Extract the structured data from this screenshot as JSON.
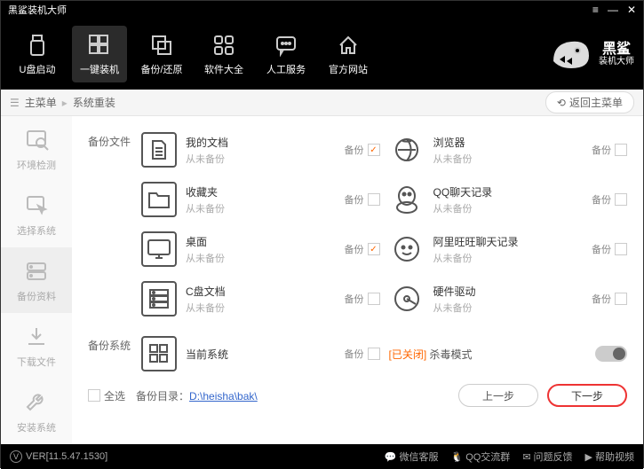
{
  "window": {
    "title": "黑鲨装机大师"
  },
  "nav": {
    "items": [
      {
        "label": "U盘启动"
      },
      {
        "label": "一键装机"
      },
      {
        "label": "备份/还原"
      },
      {
        "label": "软件大全"
      },
      {
        "label": "人工服务"
      },
      {
        "label": "官方网站"
      }
    ],
    "brand": "黑鲨",
    "brand_sub": "装机大师"
  },
  "breadcrumb": {
    "root": "主菜单",
    "current": "系统重装",
    "back": "返回主菜单"
  },
  "sidebar": {
    "items": [
      {
        "label": "环境检测"
      },
      {
        "label": "选择系统"
      },
      {
        "label": "备份资料"
      },
      {
        "label": "下载文件"
      },
      {
        "label": "安装系统"
      }
    ]
  },
  "sections": {
    "files_label": "备份文件",
    "system_label": "备份系统",
    "backup_word": "备份",
    "never": "从未备份",
    "items_left": [
      {
        "title": "我的文档",
        "checked": true
      },
      {
        "title": "收藏夹",
        "checked": false
      },
      {
        "title": "桌面",
        "checked": true
      },
      {
        "title": "C盘文档",
        "checked": false
      }
    ],
    "items_right": [
      {
        "title": "浏览器",
        "checked": false
      },
      {
        "title": "QQ聊天记录",
        "checked": false
      },
      {
        "title": "阿里旺旺聊天记录",
        "checked": false
      },
      {
        "title": "硬件驱动",
        "checked": false
      }
    ],
    "system_item": {
      "title": "当前系统",
      "checked": false
    },
    "kill": {
      "off": "[已关闭]",
      "label": " 杀毒模式"
    }
  },
  "bottom": {
    "select_all": "全选",
    "dir_label": "备份目录：",
    "dir_path": "D:\\heisha\\bak\\",
    "prev": "上一步",
    "next": "下一步"
  },
  "footer": {
    "ver": "VER[11.5.47.1530]",
    "links": [
      "微信客服",
      "QQ交流群",
      "问题反馈",
      "帮助视频"
    ]
  }
}
